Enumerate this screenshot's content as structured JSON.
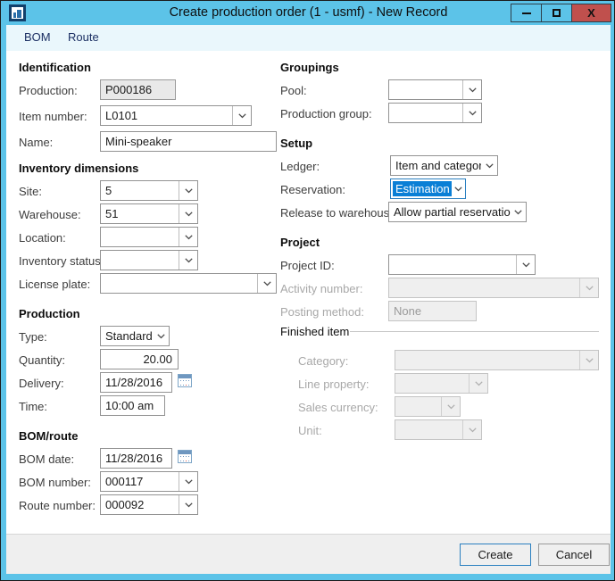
{
  "window": {
    "title": "Create production order (1 - usmf) - New Record",
    "icon": "app-icon",
    "controls": {
      "minimize": "minimize-button",
      "maximize": "maximize-button",
      "close_label": "X"
    }
  },
  "tabs": [
    {
      "label": "BOM",
      "active": true
    },
    {
      "label": "Route",
      "active": false
    }
  ],
  "left": {
    "identification": {
      "heading": "Identification",
      "fields": [
        {
          "label": "Production:",
          "value": "P000186",
          "type": "readonly"
        },
        {
          "label": "Item number:",
          "value": "L0101",
          "type": "combo"
        },
        {
          "label": "Name:",
          "value": "Mini-speaker",
          "type": "text"
        }
      ]
    },
    "inventory_dimensions": {
      "heading": "Inventory dimensions",
      "fields": [
        {
          "label": "Site:",
          "value": "5",
          "type": "combo"
        },
        {
          "label": "Warehouse:",
          "value": "51",
          "type": "combo"
        },
        {
          "label": "Location:",
          "value": "",
          "type": "combo"
        },
        {
          "label": "Inventory status:",
          "value": "",
          "type": "combo"
        },
        {
          "label": "License plate:",
          "value": "",
          "type": "combo"
        }
      ]
    },
    "production": {
      "heading": "Production",
      "fields": [
        {
          "label": "Type:",
          "value": "Standard",
          "type": "combo"
        },
        {
          "label": "Quantity:",
          "value": "20.00",
          "type": "number"
        },
        {
          "label": "Delivery:",
          "value": "11/28/2016",
          "type": "date"
        },
        {
          "label": "Time:",
          "value": "10:00 am",
          "type": "text"
        }
      ]
    },
    "bom_route": {
      "heading": "BOM/route",
      "fields": [
        {
          "label": "BOM date:",
          "value": "11/28/2016",
          "type": "date"
        },
        {
          "label": "BOM number:",
          "value": "000117",
          "type": "combo"
        },
        {
          "label": "Route number:",
          "value": "000092",
          "type": "combo"
        }
      ]
    }
  },
  "right": {
    "groupings": {
      "heading": "Groupings",
      "fields": [
        {
          "label": "Pool:",
          "value": "",
          "type": "combo"
        },
        {
          "label": "Production group:",
          "value": "",
          "type": "combo"
        }
      ]
    },
    "setup": {
      "heading": "Setup",
      "fields": [
        {
          "label": "Ledger:",
          "value": "Item and category",
          "type": "combo"
        },
        {
          "label": "Reservation:",
          "value": "Estimation",
          "type": "combo",
          "focused": true
        },
        {
          "label": "Release to warehouse:",
          "value": "Allow partial reservation",
          "type": "combo"
        }
      ]
    },
    "project": {
      "heading": "Project",
      "fields": [
        {
          "label": "Project ID:",
          "value": "",
          "type": "combo"
        },
        {
          "label": "Activity number:",
          "value": "",
          "type": "combo",
          "disabled": true
        },
        {
          "label": "Posting method:",
          "value": "None",
          "type": "text",
          "disabled": true
        }
      ]
    },
    "finished_item": {
      "heading": "Finished item",
      "fields": [
        {
          "label": "Category:",
          "value": "",
          "type": "combo",
          "disabled": true
        },
        {
          "label": "Line property:",
          "value": "",
          "type": "combo",
          "disabled": true
        },
        {
          "label": "Sales currency:",
          "value": "",
          "type": "combo",
          "disabled": true
        },
        {
          "label": "Unit:",
          "value": "",
          "type": "combo",
          "disabled": true
        }
      ]
    }
  },
  "footer": {
    "create_label": "Create",
    "cancel_label": "Cancel"
  },
  "colors": {
    "titlebar": "#5cc3e8",
    "close_button": "#c0504d",
    "tabstrip": "#eaf7fc",
    "tab_text": "#1b2f63",
    "selection_highlight": "#0a7fd6",
    "focus_border": "#2a7fc0",
    "disabled_field": "#efefef",
    "readonly_field": "#e9e9e9",
    "footer": "#efefef"
  }
}
